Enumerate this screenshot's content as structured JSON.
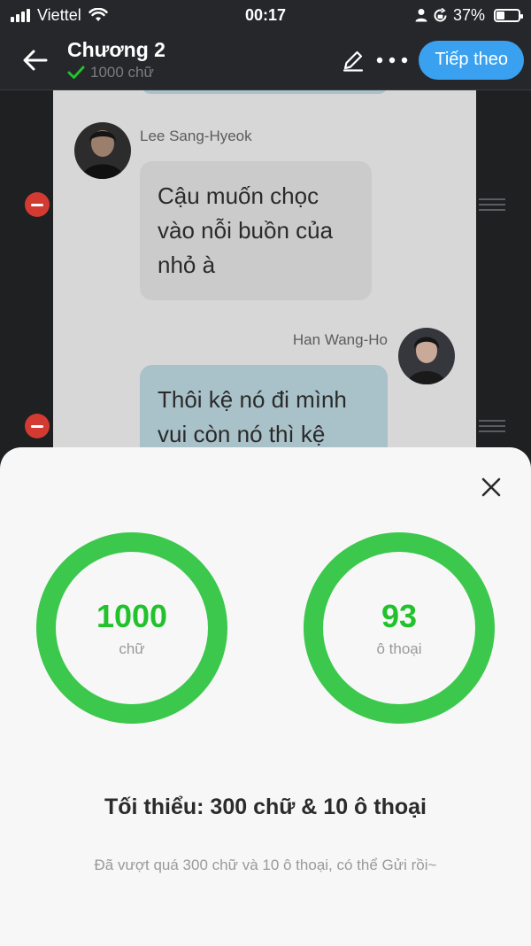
{
  "status_bar": {
    "carrier": "Viettel",
    "time": "00:17",
    "battery": "37%",
    "battery_level": 0.37
  },
  "header": {
    "title": "Chương 2",
    "subtitle": "1000 chữ",
    "next_label": "Tiếp theo"
  },
  "messages": [
    {
      "sender": "Lee Sang-Hyeok",
      "text": "Cậu muốn chọc vào nỗi buồn của nhỏ à",
      "side": "left"
    },
    {
      "sender": "Han Wang-Ho",
      "text": "Thôi kệ nó đi mình vui còn nó thì kệ",
      "side": "right"
    }
  ],
  "sheet": {
    "word_count": "1000",
    "word_label": "chữ",
    "dialog_count": "93",
    "dialog_label": "ô thoại",
    "title": "Tối thiểu: 300 chữ & 10 ô thoại",
    "note": "Đã vượt quá 300 chữ và 10 ô thoại, có thể Gửi rồi~"
  },
  "colors": {
    "accent": "#3aa1f0",
    "ring": "#3cc84c",
    "count": "#22c22c",
    "remove": "#d33a32"
  }
}
